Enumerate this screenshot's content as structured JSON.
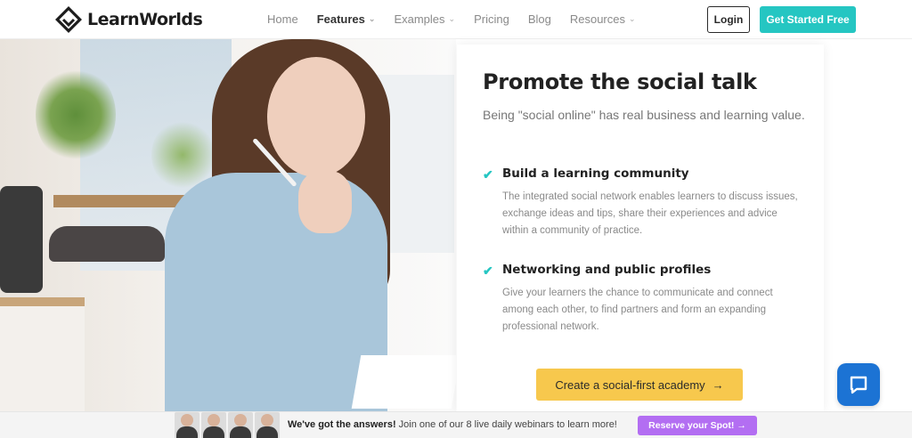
{
  "header": {
    "logo_text": "LearnWorlds",
    "nav": [
      {
        "label": "Home",
        "dropdown": false,
        "active": false
      },
      {
        "label": "Features",
        "dropdown": true,
        "active": true
      },
      {
        "label": "Examples",
        "dropdown": true,
        "active": false
      },
      {
        "label": "Pricing",
        "dropdown": false,
        "active": false
      },
      {
        "label": "Blog",
        "dropdown": false,
        "active": false
      },
      {
        "label": "Resources",
        "dropdown": true,
        "active": false
      }
    ],
    "login_label": "Login",
    "cta_label": "Get Started Free"
  },
  "main": {
    "title": "Promote the social talk",
    "subtitle": "Being \"social online\" has real business and learning value.",
    "features": [
      {
        "title": "Build a learning community",
        "description": "The integrated social network enables learners to discuss issues, exchange ideas and tips, share their experiences and advice within a community of practice."
      },
      {
        "title": "Networking and public profiles",
        "description": "Give your learners the chance to communicate and connect among each other, to find partners and form an expanding professional network."
      }
    ],
    "cta_label": "Create a social-first academy",
    "cta_arrow": "→"
  },
  "banner": {
    "bold_text": "We've got the answers!",
    "text": " Join one of our 8 live daily webinars to learn more!",
    "button_label": "Reserve your Spot!",
    "button_arrow": "→"
  },
  "icons": {
    "check": "check-icon",
    "chat": "chat-icon",
    "caret": "chevron-down-icon"
  },
  "colors": {
    "accent_teal": "#25c6c2",
    "cta_yellow": "#f7c84d",
    "chat_blue": "#1c73d4",
    "banner_button_purple": "#b36ef2"
  }
}
